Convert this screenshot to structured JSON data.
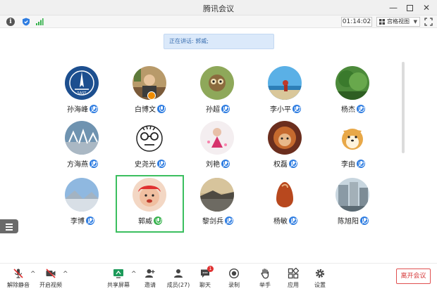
{
  "window": {
    "title": "腾讯会议"
  },
  "topbar": {
    "timer": "01:14:02",
    "view_mode": "宫格视图"
  },
  "speaking_banner": "正在讲话: 郭威;",
  "participants": [
    {
      "name": "孙海峰"
    },
    {
      "name": "白博文"
    },
    {
      "name": "孙超"
    },
    {
      "name": "李小平"
    },
    {
      "name": "杨杰"
    },
    {
      "name": "方海燕"
    },
    {
      "name": "史尧光"
    },
    {
      "name": "刘艳"
    },
    {
      "name": "权磊"
    },
    {
      "name": "李由"
    },
    {
      "name": "李博"
    },
    {
      "name": "郭威"
    },
    {
      "name": "黎剑兵"
    },
    {
      "name": "杨敏"
    },
    {
      "name": "陈旭阳"
    }
  ],
  "toolbar": {
    "unmute": "解除静音",
    "start_video": "开启视频",
    "share_screen": "共享屏幕",
    "invite": "邀请",
    "members": "成员(27)",
    "chat": "聊天",
    "record": "录制",
    "raise_hand": "举手",
    "apps": "应用",
    "settings": "设置",
    "leave": "离开会议",
    "chat_badge": "1"
  },
  "colors": {
    "accent": "#2f7de1",
    "active_speaker": "#3bbf5f",
    "leave": "#d63a3a",
    "banner_bg": "#dbe9fa"
  }
}
